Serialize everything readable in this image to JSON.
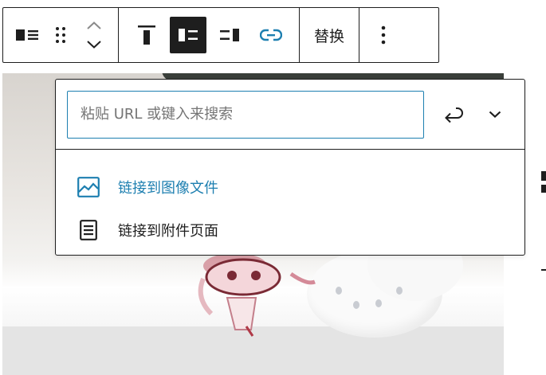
{
  "toolbar": {
    "replace_label": "替换"
  },
  "link_popover": {
    "search_placeholder": "粘贴 URL 或键入来搜索",
    "search_value": "",
    "suggestions": [
      {
        "label": "链接到图像文件",
        "icon": "image-icon"
      },
      {
        "label": "链接到附件页面",
        "icon": "page-icon"
      }
    ]
  },
  "colors": {
    "accent": "#1d7fb0",
    "text": "#1e1e1e",
    "active_bg": "#1e1e1e",
    "placeholder": "#757575"
  }
}
